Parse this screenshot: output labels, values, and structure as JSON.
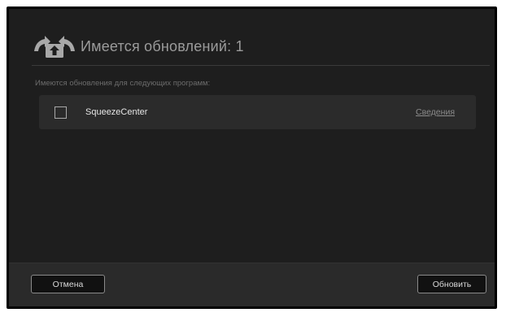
{
  "dialog": {
    "title": "Имеется обновлений: 1",
    "subtitle": "Имеются обновления для следующих программ:",
    "icon": "update-upload-icon"
  },
  "updates": [
    {
      "name": "SqueezeCenter",
      "checked": false,
      "details_label": "Сведения"
    }
  ],
  "footer": {
    "cancel_label": "Отмена",
    "update_label": "Обновить"
  },
  "colors": {
    "background": "#1e1e1e",
    "row_background": "#2b2b2b",
    "footer_background": "#2a2a2a",
    "title_text": "#9b9b9b",
    "icon": "#a8a8a8"
  }
}
